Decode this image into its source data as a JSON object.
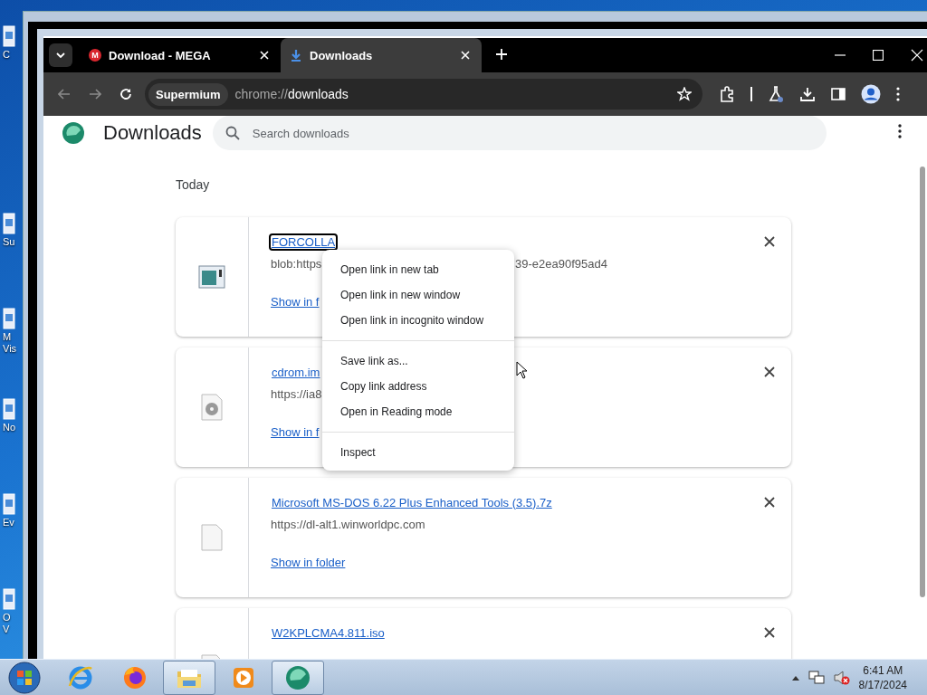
{
  "desktop": {
    "icons": [
      {
        "label": "C"
      },
      {
        "label": "Su"
      },
      {
        "label": "M\nVis"
      },
      {
        "label": "No"
      },
      {
        "label": "Ev"
      },
      {
        "label": "O\nV"
      }
    ]
  },
  "browser": {
    "tabs": [
      {
        "title": "Download - MEGA",
        "selected": false,
        "kind": "mega",
        "badge": "M"
      },
      {
        "title": "Downloads",
        "selected": true,
        "kind": "download"
      }
    ],
    "address": {
      "chip": "Supermium",
      "scheme": "chrome://",
      "path": "downloads"
    }
  },
  "page": {
    "title": "Downloads",
    "search": {
      "placeholder": "Search downloads"
    },
    "section": "Today",
    "downloads": [
      {
        "name": "FORCOLLA",
        "url_parts": [
          "blob:https",
          "39-e2ea90f95ad4"
        ],
        "action": "Show in f",
        "kind": "app",
        "focused": true
      },
      {
        "name": "cdrom.im",
        "url_parts": [
          "https://ia8"
        ],
        "action": "Show in f",
        "kind": "disc",
        "focused": false
      },
      {
        "name": "Microsoft MS-DOS 6.22 Plus Enhanced Tools (3.5).7z",
        "url_parts": [
          "https://dl-alt1.winworldpc.com"
        ],
        "action": "Show in folder",
        "kind": "file",
        "focused": false
      },
      {
        "name": "W2KPLCMA4.811.iso",
        "kind": "file",
        "focused": false
      }
    ]
  },
  "context_menu": {
    "groups": [
      [
        "Open link in new tab",
        "Open link in new window",
        "Open link in incognito window"
      ],
      [
        "Save link as...",
        "Copy link address",
        "Open in Reading mode"
      ],
      [
        "Inspect"
      ]
    ]
  },
  "taskbar": {
    "apps": [
      {
        "kind": "ie",
        "active": false
      },
      {
        "kind": "firefox",
        "active": false
      },
      {
        "kind": "explorer",
        "active": true
      },
      {
        "kind": "media",
        "active": false
      },
      {
        "kind": "browser",
        "active": true
      }
    ],
    "time": "6:41 AM",
    "date": "8/17/2024"
  }
}
